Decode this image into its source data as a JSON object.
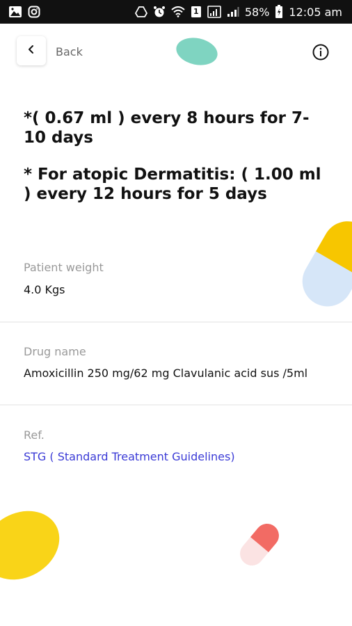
{
  "status_bar": {
    "battery_percent": "58%",
    "time": "12:05 am",
    "sim_label": "1"
  },
  "header": {
    "back_label": "Back"
  },
  "dosage": {
    "line1": "*( 0.67 ml ) every 8 hours for 7-10 days",
    "line2": "* For atopic Dermatitis: ( 1.00 ml ) every 12 hours for 5 days"
  },
  "patient_weight": {
    "label": "Patient weight",
    "value": "4.0 Kgs"
  },
  "drug_name": {
    "label": "Drug name",
    "value": "Amoxicillin 250 mg/62 mg Clavulanic acid sus /5ml"
  },
  "reference": {
    "label": "Ref.",
    "value": "STG ( Standard Treatment Guidelines)"
  },
  "colors": {
    "link": "#3a3ad6",
    "teal_pill": "#7fd4c1",
    "yellow_pill": "#f7c600",
    "blue_pill": "#d6e6f8",
    "red_pill": "#f26b64",
    "pink_pill": "#fbe3e3",
    "yellow_blob": "#f9d418"
  }
}
